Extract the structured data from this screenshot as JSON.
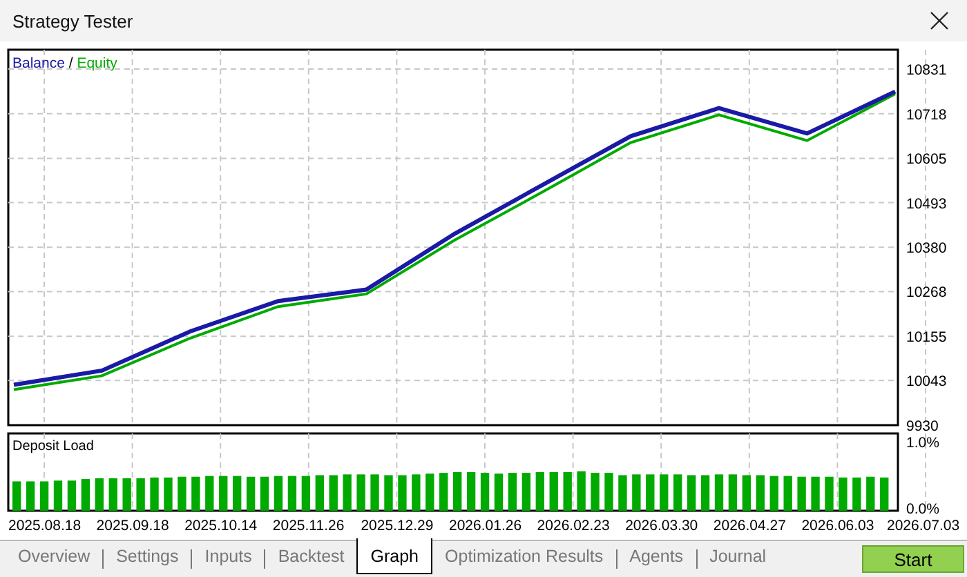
{
  "window": {
    "title": "Strategy Tester"
  },
  "graph": {
    "legend_separator": "/",
    "chart_data": {
      "type": "line",
      "grid": true,
      "categories": [
        "2025.08.18",
        "2025.09.18",
        "2025.10.14",
        "2025.11.26",
        "2025.12.29",
        "2026.01.26",
        "2026.02.23",
        "2026.03.30",
        "2026.04.27",
        "2026.06.03",
        "2026.07.03"
      ],
      "series": [
        {
          "name": "Balance",
          "color": "#1a1aa6",
          "values": [
            10032,
            10068,
            10167,
            10244,
            10273,
            10414,
            10538,
            10661,
            10732,
            10668,
            10774
          ]
        },
        {
          "name": "Equity",
          "color": "#00aa00",
          "values": [
            10020,
            10055,
            10150,
            10230,
            10262,
            10398,
            10520,
            10645,
            10715,
            10650,
            10768
          ]
        }
      ],
      "ylim": [
        9930,
        10831
      ],
      "yticks": [
        9930,
        10043,
        10155,
        10268,
        10380,
        10493,
        10605,
        10718,
        10831
      ]
    }
  },
  "deposit_load": {
    "title": "Deposit Load",
    "top_label": "1.0%",
    "bottom_label": "0.0%"
  },
  "tabs": [
    {
      "label": "Overview",
      "selected": false
    },
    {
      "label": "Settings",
      "selected": false
    },
    {
      "label": "Inputs",
      "selected": false
    },
    {
      "label": "Backtest",
      "selected": false
    },
    {
      "label": "Graph",
      "selected": true
    },
    {
      "label": "Optimization Results",
      "selected": false
    },
    {
      "label": "Agents",
      "selected": false
    },
    {
      "label": "Journal",
      "selected": false
    }
  ],
  "start_button": "Start"
}
